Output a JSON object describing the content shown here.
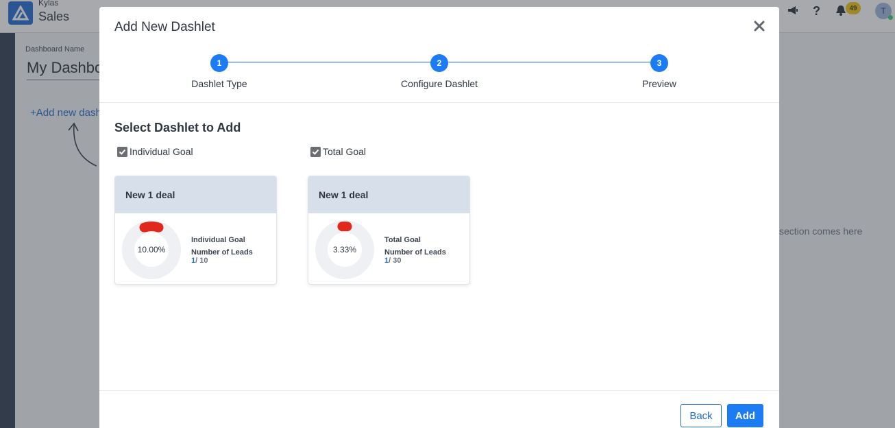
{
  "app": {
    "brand": "Kylas",
    "product": "Sales",
    "notification_count": "49",
    "avatar_initial": "T",
    "dashboard_name_label": "Dashboard Name",
    "dashboard_name": "My Dashboard",
    "add_new_dashlet_link": "Add new dashlet",
    "section_hint": "section comes here"
  },
  "modal": {
    "title": "Add New Dashlet",
    "close_icon": "close-icon",
    "steps": [
      {
        "number": "1",
        "label": "Dashlet Type"
      },
      {
        "number": "2",
        "label": "Configure Dashlet"
      },
      {
        "number": "3",
        "label": "Preview"
      }
    ],
    "section_title": "Select Dashlet to Add",
    "options": [
      {
        "checkbox_label": "Individual Goal",
        "checked": true,
        "card_title": "New 1 deal",
        "percent_label": "10.00%",
        "percent_value": 10.0,
        "goal_type": "Individual Goal",
        "metric": "Number of Leads",
        "achieved": "1",
        "target": "/ 10"
      },
      {
        "checkbox_label": "Total Goal",
        "checked": true,
        "card_title": "New 1 deal",
        "percent_label": "3.33%",
        "percent_value": 3.33,
        "goal_type": "Total Goal",
        "metric": "Number of Leads",
        "achieved": "1",
        "target": "/ 30"
      }
    ],
    "buttons": {
      "back": "Back",
      "add": "Add"
    }
  },
  "colors": {
    "primary": "#1c7cf4",
    "progress_red": "#e0281d",
    "card_header": "#d7e0ea"
  }
}
